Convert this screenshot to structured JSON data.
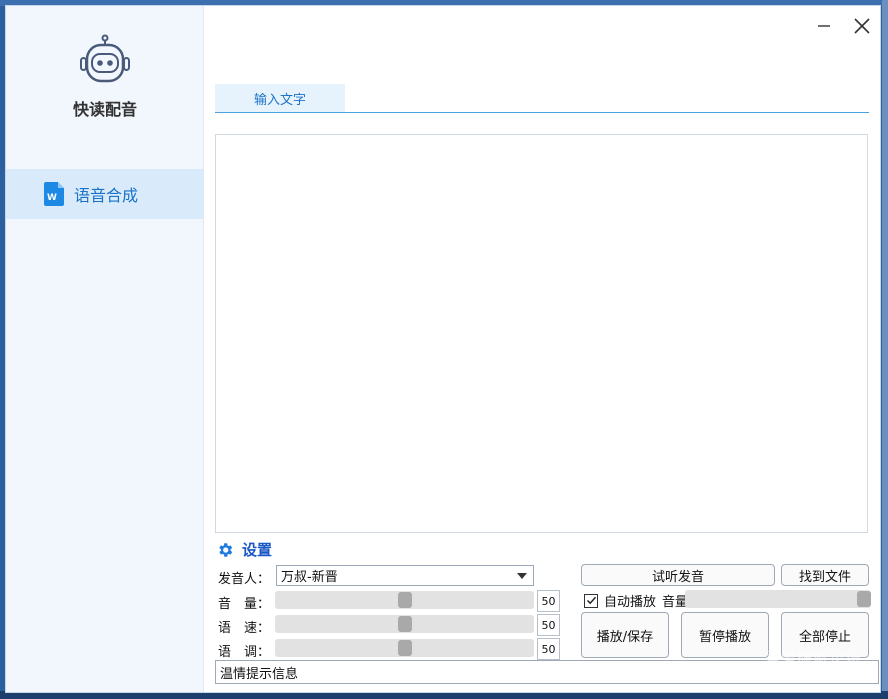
{
  "app": {
    "name": "快读配音"
  },
  "sidebar": {
    "items": [
      {
        "label": "语音合成"
      }
    ]
  },
  "tabs": [
    {
      "label": "输入文字"
    }
  ],
  "editor": {
    "value": ""
  },
  "settings": {
    "title": "设置",
    "speaker": {
      "label": "发音人：",
      "value": "万叔-新晋"
    },
    "volume": {
      "label": "音　量：",
      "value": "50",
      "level": 0.5
    },
    "speed": {
      "label": "语　速：",
      "value": "50",
      "level": 0.5
    },
    "pitch": {
      "label": "语　调：",
      "value": "50",
      "level": 0.5
    }
  },
  "buttons": {
    "preview": "试听发音",
    "find_file": "找到文件",
    "play_save": "播放/保存",
    "pause": "暂停播放",
    "stop_all": "全部停止"
  },
  "autoplay": {
    "label": "自动播放",
    "checked": true,
    "volume_label": "音量",
    "volume_level": 1.0
  },
  "hint": {
    "text": "温情提示信息"
  },
  "watermark": {
    "line1": "吾爱破解论坛",
    "line2": "www.52pojie.cn"
  },
  "colors": {
    "accent": "#1a73c9",
    "settings_title": "#1a56c4",
    "sidebar_bg": "#f1f7fd",
    "nav_active": "#d9eafa"
  },
  "icons": {
    "logo": "robot-icon",
    "nav": "word-doc-icon",
    "settings": "gear-icon",
    "minimize": "minimize-icon",
    "close": "close-icon",
    "dropdown": "chevron-down-icon",
    "check": "check-icon"
  }
}
